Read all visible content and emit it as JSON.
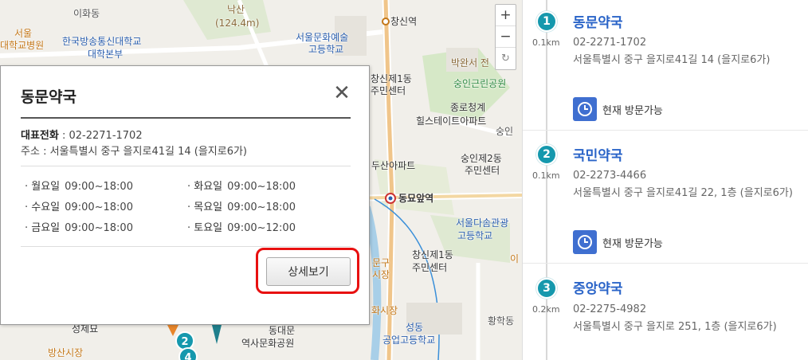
{
  "map": {
    "zoom_in": "+",
    "zoom_out": "−",
    "refresh": "↻",
    "labels": {
      "ihwadong": "이화동",
      "naksan": "낙산",
      "naksan_height": "(124.4m)",
      "changsin_station": "창신역",
      "seoul": "서울",
      "univ_hospital": "대학교병원",
      "broadcast_univ": "한국방송통신대학교",
      "broadcast_hq": "대학본부",
      "seoul_arts_hs": "서울문화예술",
      "arts_hs_2": "고등학교",
      "park_museum": "박완서 전",
      "changsin1_center": "창신제1동",
      "changsin1_center2": "주민센터",
      "sungin_park": "숭인근린공원",
      "jongno_hills": "종로청계",
      "hills_apt": "힐스테이트아파트",
      "sungin": "숭인",
      "dusan_apt": "두산아파트",
      "changsin2_center": "숭인제2동",
      "changsin2_center2": "주민센터",
      "dongmyo_station": "동묘앞역",
      "dasom_hs": "서울다솜관광",
      "dasom_hs2": "고등학교",
      "changsin1_2": "창신제1동",
      "changsin1_2b": "주민센터",
      "market_a": "문구",
      "market_b": "시장",
      "hwamarket": "화시장",
      "hwanghak": "황학동",
      "seongdong_hs": "성동",
      "seongdong_hs2": "공업고등학교",
      "dongdaemun": "동대문",
      "history_park": "역사문화공원",
      "seongjemyo": "성제묘",
      "bangsan_market": "방산시장",
      "side_char": "이"
    }
  },
  "popup": {
    "title": "동문약국",
    "close": "✕",
    "phone_label": "대표전화",
    "phone": ": 02-2271-1702",
    "addr_label": "주소",
    "addr": ": 서울특별시 중구 을지로41길 14 (을지로6가)",
    "hours": [
      {
        "day": "월요일",
        "time": "09:00~18:00"
      },
      {
        "day": "화요일",
        "time": "09:00~18:00"
      },
      {
        "day": "수요일",
        "time": "09:00~18:00"
      },
      {
        "day": "목요일",
        "time": "09:00~18:00"
      },
      {
        "day": "금요일",
        "time": "09:00~18:00"
      },
      {
        "day": "토요일",
        "time": "09:00~12:00"
      }
    ],
    "detail_button": "상세보기"
  },
  "pharmacies": [
    {
      "num": "1",
      "distance": "0.1km",
      "name": "동문약국",
      "phone": "02-2271-1702",
      "address": "서울특별시 중구 을지로41길 14 (을지로6가)",
      "status": "현재 방문가능"
    },
    {
      "num": "2",
      "distance": "0.1km",
      "name": "국민약국",
      "phone": "02-2273-4466",
      "address": "서울특별시 중구 을지로41길 22, 1층 (을지로6가)",
      "status": "현재 방문가능"
    },
    {
      "num": "3",
      "distance": "0.2km",
      "name": "중앙약국",
      "phone": "02-2275-4982",
      "address": "서울특별시 중구 을지로 251, 1층 (을지로6가)",
      "status": ""
    }
  ],
  "colors": {
    "accent_teal": "#1598ad",
    "link_blue": "#2a64c8",
    "highlight_red": "#e81010",
    "clock_blue": "#3f6fd0"
  }
}
